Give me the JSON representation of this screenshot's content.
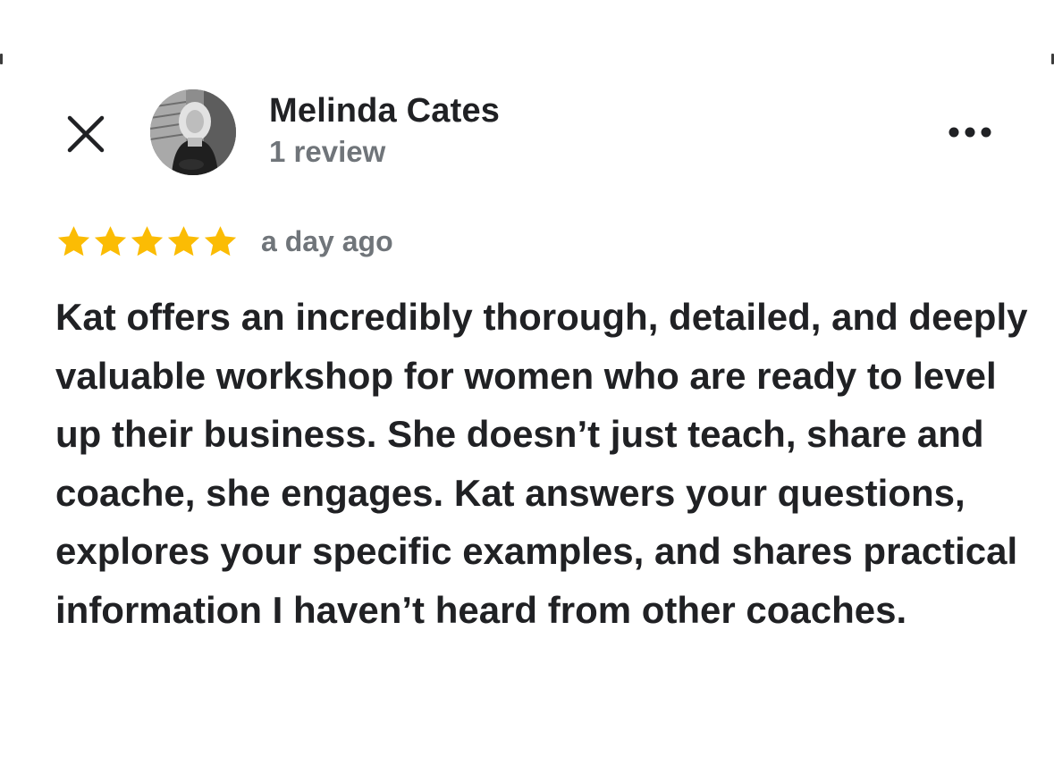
{
  "reviewer": {
    "name": "Melinda Cates",
    "review_count": "1 review"
  },
  "review": {
    "rating": 5,
    "max_rating": 5,
    "date": "a day ago",
    "text": "Kat offers an incredibly thorough, detailed, and deeply valuable workshop for women who are ready to level up their business. She doesn’t just teach, share and coache, she engages. Kat answers your questions, explores your specific examples, and shares practical information I haven’t heard from other coaches."
  },
  "icons": {
    "close": "close-icon",
    "more": "more-options-icon",
    "star": "star-icon"
  },
  "colors": {
    "star": "#fbbc04",
    "primary_text": "#202124",
    "secondary_text": "#70757a"
  }
}
